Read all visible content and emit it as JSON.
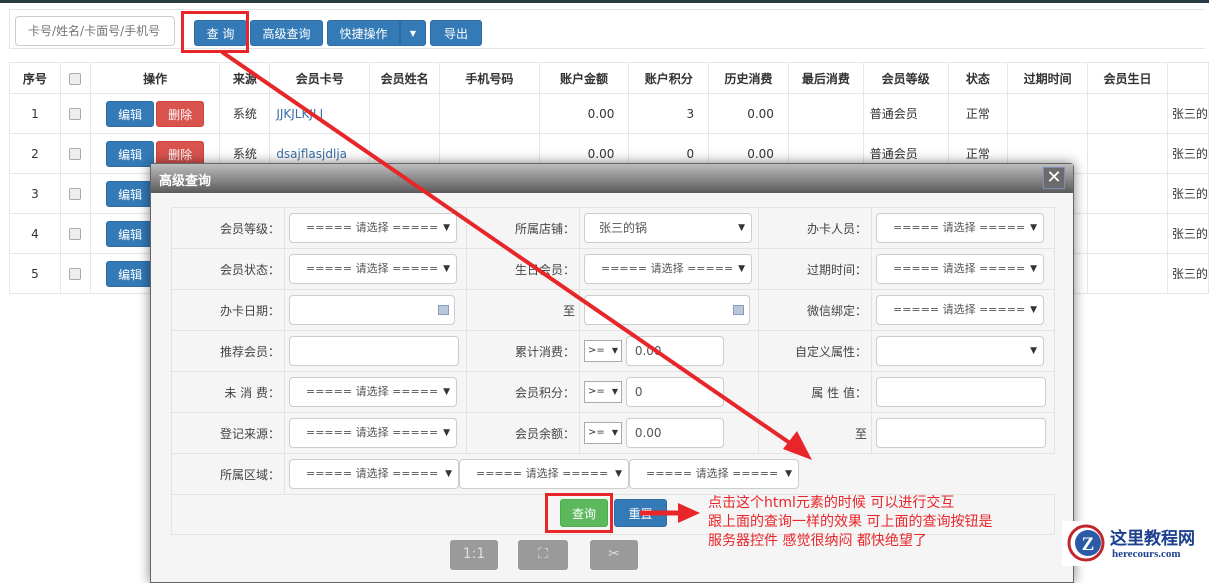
{
  "toolbar": {
    "search_placeholder": "卡号/姓名/卡面号/手机号",
    "query": "查 询",
    "advanced": "高级查询",
    "quick": "快捷操作",
    "export": "导出"
  },
  "table": {
    "headers": [
      "序号",
      "",
      "操作",
      "来源",
      "会员卡号",
      "会员姓名",
      "手机号码",
      "账户金额",
      "账户积分",
      "历史消费",
      "最后消费",
      "会员等级",
      "状态",
      "过期时间",
      "会员生日",
      ""
    ],
    "edit": "编辑",
    "delete": "删除",
    "rows": [
      {
        "no": "1",
        "source": "系统",
        "card": "JJKJLKJLJ",
        "amount": "0.00",
        "points": "3",
        "history": "0.00",
        "level": "普通会员",
        "status": "正常",
        "store": "张三的"
      },
      {
        "no": "2",
        "source": "系统",
        "card": "dsajflasjdlja",
        "amount": "0.00",
        "points": "0",
        "history": "0.00",
        "level": "普通会员",
        "status": "正常",
        "store": "张三的"
      },
      {
        "no": "3",
        "store": "张三的"
      },
      {
        "no": "4",
        "store": "张三的"
      },
      {
        "no": "5",
        "store": "张三的"
      }
    ]
  },
  "dialog": {
    "title": "高级查询",
    "placeholder": "===== 请选择 =====",
    "labels": {
      "level": "会员等级：",
      "store": "所属店铺：",
      "staff": "办卡人员：",
      "status": "会员状态：",
      "birthday": "生日会员：",
      "expire": "过期时间：",
      "card_date": "办卡日期：",
      "to": "至",
      "wechat": "微信绑定：",
      "referrer": "推荐会员：",
      "total_spend": "累计消费：",
      "custom_attr": "自定义属性：",
      "no_spend": "未 消 费：",
      "points": "会员积分：",
      "attr_value": "属 性 值：",
      "reg_source": "登记来源：",
      "balance": "会员余额：",
      "to2": "至",
      "region": "所属区域："
    },
    "store_value": "张三的锅",
    "op": ">=",
    "total_spend_value": "0.00",
    "points_value": "0",
    "balance_value": "0.00",
    "query": "查询",
    "reset": "重置"
  },
  "bottom_icons": [
    "1:1",
    "fullscreen-icon",
    "screenshot-icon"
  ],
  "annotation": [
    "点击这个html元素的时候 可以进行交互",
    "跟上面的查询一样的效果  可上面的查询按钮是",
    "服务器控件 感觉很纳闷 都快绝望了"
  ],
  "watermark": {
    "name": "这里教程网",
    "url": "herecours.com"
  },
  "colors": {
    "primary": "#337ab7",
    "danger": "#d9534f",
    "success": "#5cb85c",
    "annotation": "#e8262a"
  }
}
